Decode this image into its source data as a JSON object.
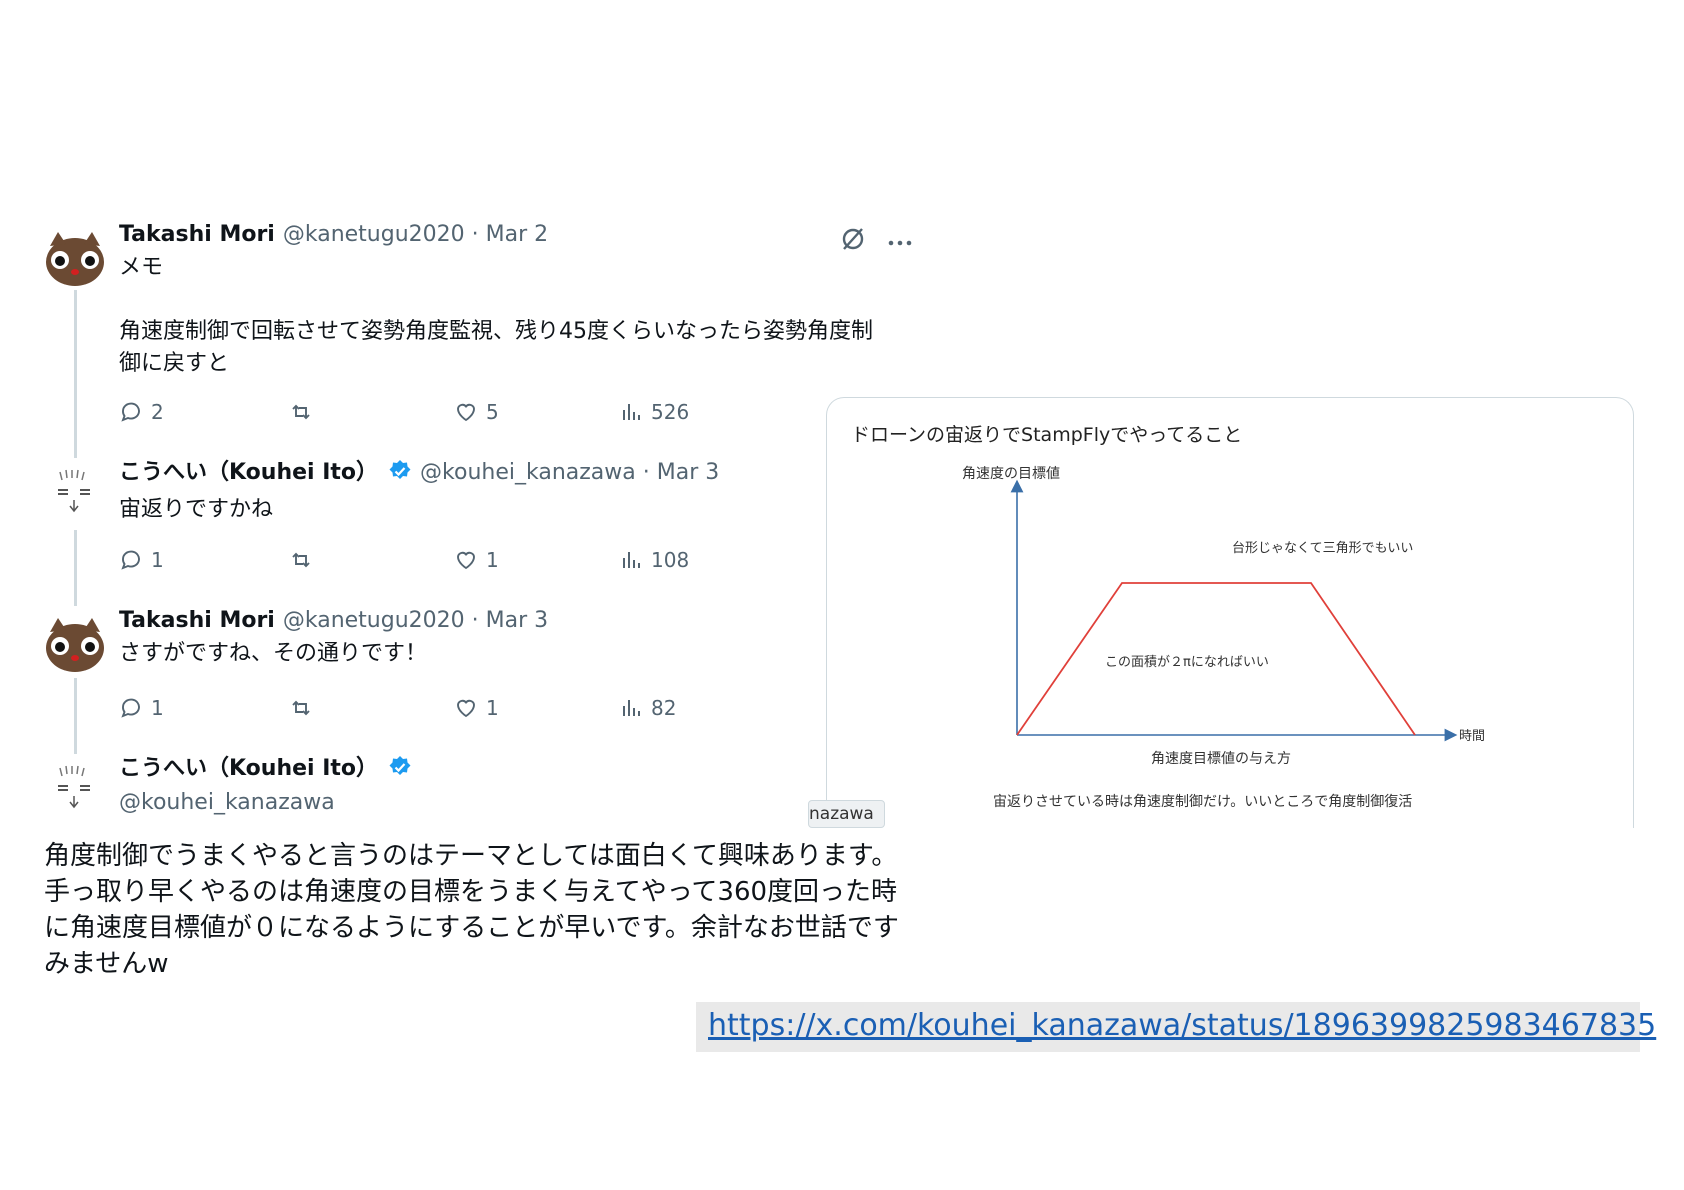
{
  "tweets": [
    {
      "name": "Takashi Mori",
      "handle": "@kanetugu2020",
      "date": "· Mar 2",
      "text": "メモ\n\n角速度制御で回転させて姿勢角度監視、残り45度くらいなったら姿勢角度制\n御に戻すと",
      "replies": "2",
      "likes": "5",
      "views": "526"
    },
    {
      "name": "こうへい（Kouhei Ito）",
      "handle": "@kouhei_kanazawa",
      "date": "· Mar 3",
      "text": "宙返りですかね",
      "replies": "1",
      "likes": "1",
      "views": "108"
    },
    {
      "name": "Takashi Mori",
      "handle": "@kanetugu2020",
      "date": "· Mar 3",
      "text": "さすがですね、その通りです！",
      "replies": "1",
      "likes": "1",
      "views": "82"
    },
    {
      "name": "こうへい（Kouhei Ito）",
      "handle": "@kouhei_kanazawa"
    }
  ],
  "reply_text": "角度制御でうまくやると言うのはテーマとしては面白くて興味あります。\n手っ取り早くやるのは角速度の目標をうまく与えてやって360度回った時\nに角速度目標値が０になるようにすることが早いです。余計なお世話です\nみませんw",
  "card": {
    "title": "ドローンの宙返りでStampFlyでやってること",
    "tag": "nazawa",
    "diagram": {
      "y_axis_label": "角速度の目標値",
      "x_axis_label": "時間",
      "note_top": "台形じゃなくて三角形でもいい",
      "note_area": "この面積が２πになればいい",
      "caption": "角速度目標値の与え方",
      "footer": "宙返りさせている時は角速度制御だけ。いいところで角度制御復活"
    }
  },
  "url": "https://x.com/kouhei_kanazawa/status/1896399825983467835",
  "colors": {
    "text": "#0f1419",
    "muted": "#536471",
    "verified": "#1d9bf0",
    "trapezoid": "#e0403a",
    "axis": "#3a6fa8",
    "link": "#1a5fb4"
  }
}
